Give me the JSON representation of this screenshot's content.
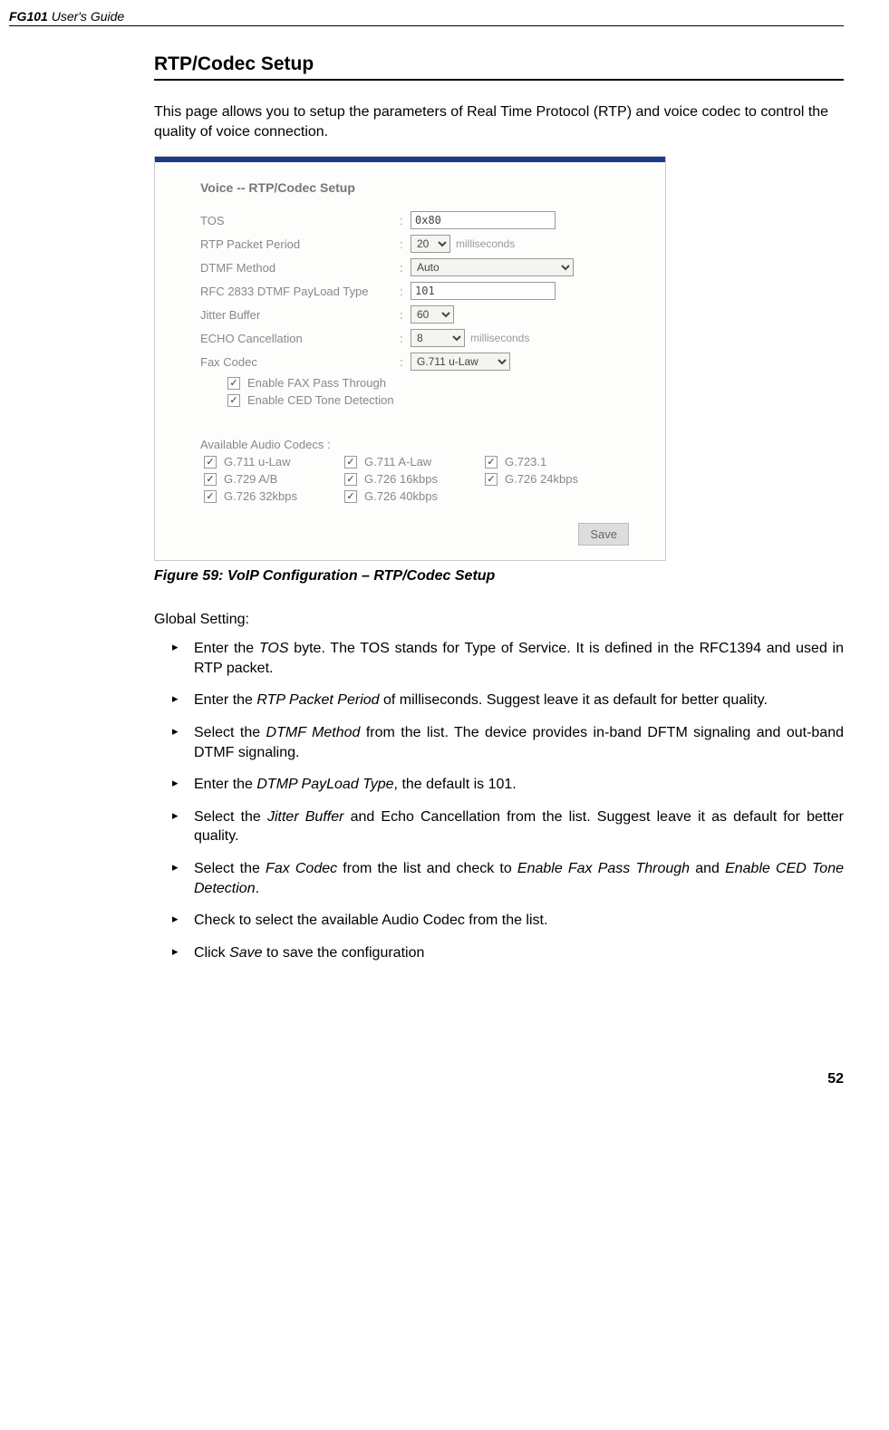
{
  "header": {
    "product": "FG101",
    "guide": "User's Guide"
  },
  "section_title": "RTP/Codec Setup",
  "intro": "This page allows you to setup the parameters of Real Time Protocol (RTP) and voice codec to control the quality of voice connection.",
  "figure": {
    "title": "Voice -- RTP/Codec Setup",
    "rows": {
      "tos": {
        "label": "TOS",
        "value": "0x80"
      },
      "rtp": {
        "label": "RTP Packet Period",
        "value": "20",
        "unit": "milliseconds"
      },
      "dtmf": {
        "label": "DTMF Method",
        "value": "Auto"
      },
      "rfc": {
        "label": "RFC 2833 DTMF PayLoad Type",
        "value": "101"
      },
      "jitter": {
        "label": "Jitter Buffer",
        "value": "60"
      },
      "echo": {
        "label": "ECHO Cancellation",
        "value": "8",
        "unit": "milliseconds"
      },
      "fax": {
        "label": "Fax Codec",
        "value": "G.711 u-Law"
      }
    },
    "checks": {
      "fax_pass": "Enable FAX Pass Through",
      "ced": "Enable CED Tone Detection"
    },
    "codecs_label": "Available Audio Codecs  :",
    "codecs": [
      [
        "G.711 u-Law",
        "G.711 A-Law",
        "G.723.1"
      ],
      [
        "G.729 A/B",
        "G.726 16kbps",
        "G.726 24kbps"
      ],
      [
        "G.726 32kbps",
        "G.726 40kbps",
        ""
      ]
    ],
    "save": "Save"
  },
  "caption": "Figure 59: VoIP Configuration – RTP/Codec Setup",
  "global_label": "Global Setting:",
  "bullets": [
    {
      "pre": "Enter the ",
      "em": "TOS",
      "post": " byte. The TOS stands for Type of Service. It is defined in the RFC1394 and used in RTP packet."
    },
    {
      "pre": "Enter the ",
      "em": "RTP Packet Period",
      "post": " of milliseconds. Suggest leave it as default for better quality."
    },
    {
      "pre": "Select the ",
      "em": "DTMF Method",
      "post": " from the list. The device provides in-band DFTM signaling and out-band DTMF signaling."
    },
    {
      "pre": "Enter the ",
      "em": "DTMP PayLoad Type",
      "post": ", the default is 101."
    },
    {
      "pre": "Select the ",
      "em": "Jitter Buffer",
      "post": " and Echo Cancellation from the list. Suggest leave it as default for better quality."
    },
    {
      "pre": "Select the ",
      "em": "Fax Codec",
      "post": " from the list and check to ",
      "em2": "Enable Fax Pass Through",
      "post2": " and ",
      "em3": "Enable CED Tone Detection",
      "post3": "."
    },
    {
      "pre": "Check to select the available Audio Codec from the list.",
      "em": "",
      "post": ""
    },
    {
      "pre": "Click ",
      "em": "Save",
      "post": " to save the configuration"
    }
  ],
  "page": "52"
}
